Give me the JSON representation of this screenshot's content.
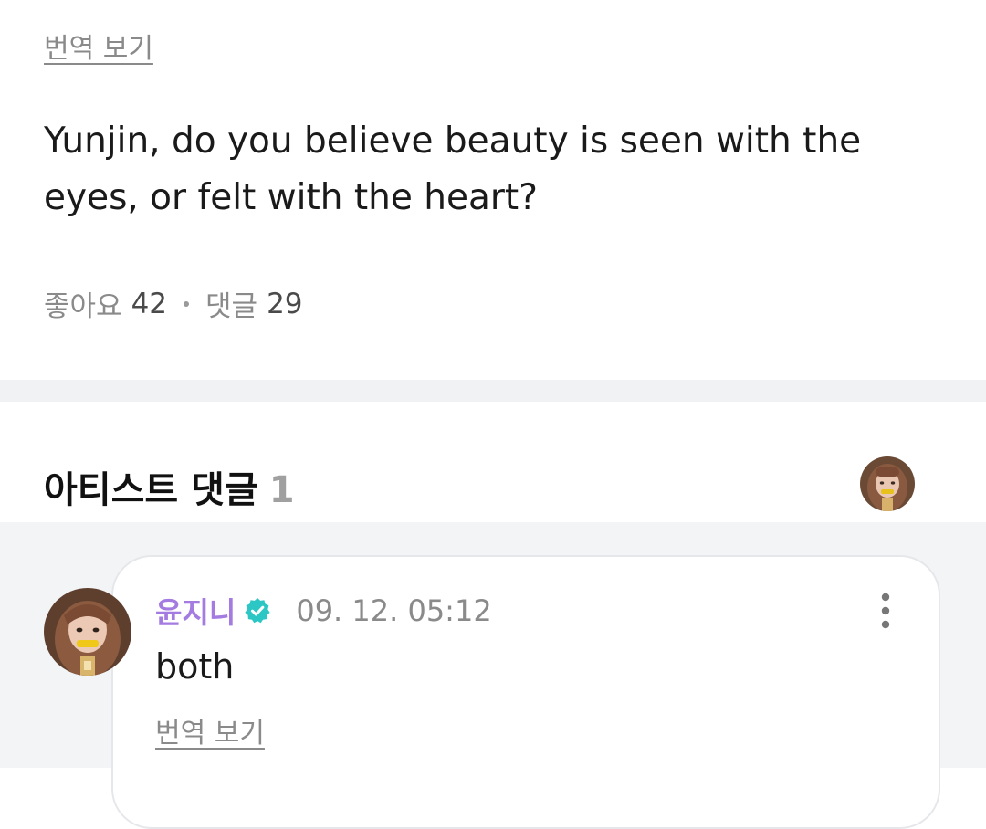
{
  "post": {
    "translate_label": "번역 보기",
    "body_line1": "Yunjin, do you believe beauty is seen with the",
    "body_line2": "eyes, or felt with the heart?",
    "likes_label": "좋아요",
    "likes_count": "42",
    "comments_label": "댓글",
    "comments_count": "29"
  },
  "artist_comments": {
    "title": "아티스트 댓글",
    "count": "1"
  },
  "comment": {
    "author": "윤지니",
    "verified_icon": "verified-badge-icon",
    "timestamp": "09. 12. 05:12",
    "text": "both",
    "translate_label": "번역 보기",
    "more_icon": "more-vertical-icon"
  },
  "colors": {
    "author_name": "#a47be0",
    "verified_badge": "#2cc7c5",
    "muted_text": "#8a8a8a",
    "divider": "#f1f2f4"
  }
}
